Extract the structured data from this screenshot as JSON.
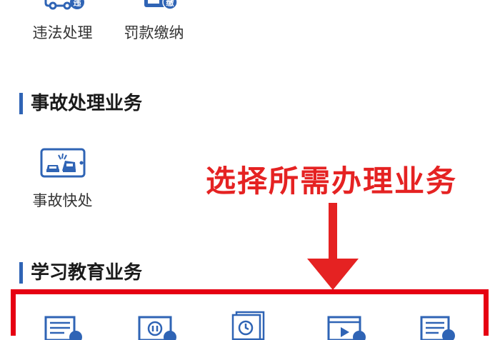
{
  "violation_services": {
    "items": [
      {
        "label": "违法处理",
        "badge": "违",
        "icon": "traffic-violation-icon"
      },
      {
        "label": "罚款缴纳",
        "badge": "缴",
        "icon": "fine-payment-icon"
      }
    ]
  },
  "accident_section": {
    "title": "事故处理业务",
    "items": [
      {
        "label": "事故快处",
        "icon": "accident-quick-handling-icon"
      }
    ]
  },
  "education_section": {
    "title": "学习教育业务",
    "items": [
      {
        "icon": "document-icon"
      },
      {
        "icon": "pause-screen-icon"
      },
      {
        "icon": "clock-document-icon"
      },
      {
        "icon": "video-play-icon"
      },
      {
        "icon": "exam-document-icon"
      }
    ]
  },
  "annotation": {
    "text": "选择所需办理业务"
  },
  "colors": {
    "accent_blue": "#2f64b5",
    "annotation_red": "#e52222",
    "highlight_red": "#e60012"
  }
}
